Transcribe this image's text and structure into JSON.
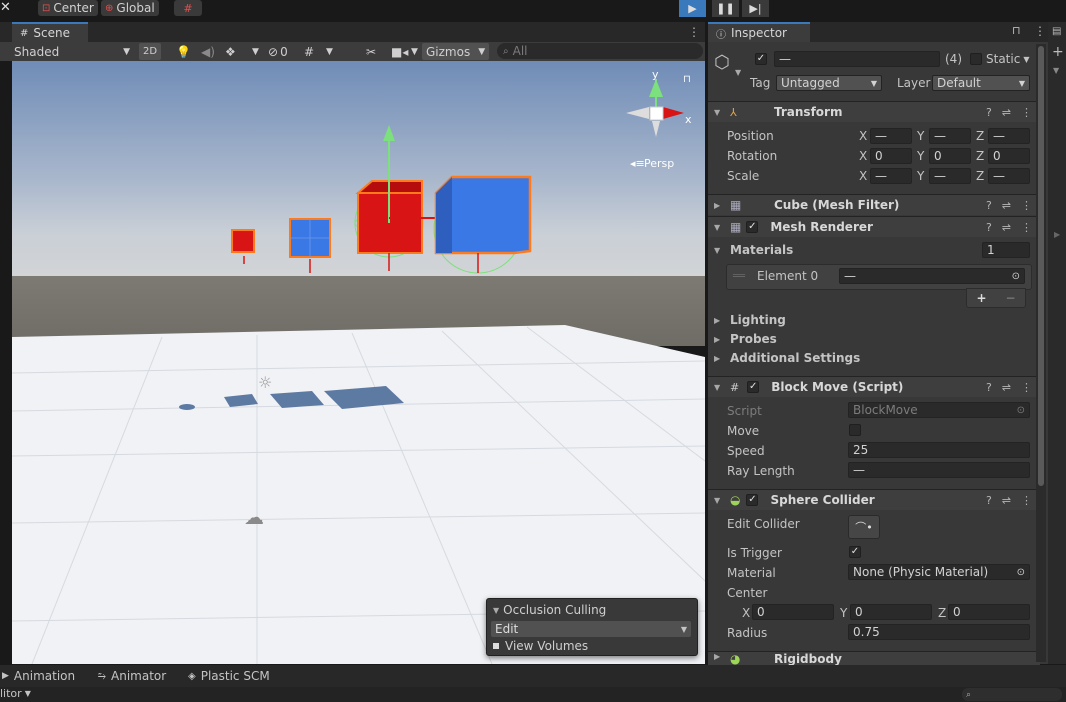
{
  "toolbar": {
    "pivot_label": "Center",
    "space_label": "Global",
    "play_icon": "play-icon",
    "pause_icon": "pause-icon",
    "step_icon": "step-icon"
  },
  "scene": {
    "tab_label": "Scene",
    "shading_mode": "Shaded",
    "mode_2d_label": "2D",
    "hidden_count": "0",
    "gizmos_label": "Gizmos",
    "search_placeholder": "All",
    "perspective_label": "Persp",
    "gizmo_axis_y": "y",
    "gizmo_axis_x": "x"
  },
  "occlusion": {
    "title": "Occlusion Culling",
    "mode_value": "Edit",
    "view_volumes_label": "View Volumes"
  },
  "inspector": {
    "tab_label": "Inspector",
    "object_name": "—",
    "selection_count": "(4)",
    "static_label": "Static",
    "tag_label": "Tag",
    "tag_value": "Untagged",
    "layer_label": "Layer",
    "layer_value": "Default",
    "transform": {
      "title": "Transform",
      "rows": [
        {
          "label": "Position",
          "x": "—",
          "y": "—",
          "z": "—"
        },
        {
          "label": "Rotation",
          "x": "0",
          "y": "0",
          "z": "0"
        },
        {
          "label": "Scale",
          "x": "—",
          "y": "—",
          "z": "—"
        }
      ],
      "axis_x": "X",
      "axis_y": "Y",
      "axis_z": "Z"
    },
    "mesh_filter": {
      "title": "Cube (Mesh Filter)"
    },
    "mesh_renderer": {
      "title": "Mesh Renderer",
      "materials_label": "Materials",
      "materials_count": "1",
      "element_label": "Element 0",
      "element_value": "—",
      "add_label": "+",
      "remove_label": "−",
      "sections": [
        "Lighting",
        "Probes",
        "Additional Settings"
      ]
    },
    "block_move": {
      "title": "Block Move (Script)",
      "script_label": "Script",
      "script_value": "BlockMove",
      "move_label": "Move",
      "speed_label": "Speed",
      "speed_value": "25",
      "ray_label": "Ray Length",
      "ray_value": "—"
    },
    "sphere_collider": {
      "title": "Sphere Collider",
      "edit_label": "Edit Collider",
      "trigger_label": "Is Trigger",
      "material_label": "Material",
      "material_value": "None (Physic Material)",
      "center_label": "Center",
      "center_x": "0",
      "center_y": "0",
      "center_z": "0",
      "radius_label": "Radius",
      "radius_value": "0.75"
    },
    "rigidbody": {
      "title": "Rigidbody"
    }
  },
  "bottom": {
    "tabs": [
      "Animation",
      "Animator",
      "Plastic SCM"
    ],
    "status_left": "litor"
  },
  "colors": {
    "accent": "#3a79bb",
    "cube_red": "#d81414",
    "cube_blue": "#3a78e6",
    "selection_outline": "#ff7a1a",
    "sky_top": "#6b8bb8",
    "ground": "#f1f3f6"
  }
}
